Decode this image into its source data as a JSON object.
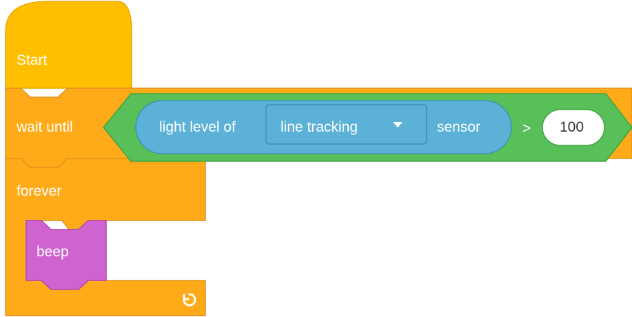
{
  "colors": {
    "hat_fill": "#FFBF00",
    "hat_stroke": "#E6A800",
    "control_fill": "#FFAB19",
    "control_stroke": "#E0911E",
    "operator_fill": "#59C059",
    "operator_stroke": "#3FA33F",
    "sensing_fill": "#5CB1D6",
    "sensing_stroke": "#3E8FB5",
    "sound_fill": "#CF63CF",
    "sound_stroke": "#B045B0",
    "text": "#FFFFFF"
  },
  "blocks": {
    "start": {
      "label": "Start"
    },
    "wait_until": {
      "label": "wait until",
      "condition": {
        "operator": ">",
        "left": {
          "prefix": "light level of",
          "dropdown": {
            "value": "line tracking",
            "icon": "caret-down-icon"
          },
          "suffix": "sensor"
        },
        "right_value": "100"
      }
    },
    "forever": {
      "label": "forever",
      "loop_icon": "loop-arrow-icon",
      "body": [
        {
          "label": "beep"
        }
      ]
    }
  }
}
